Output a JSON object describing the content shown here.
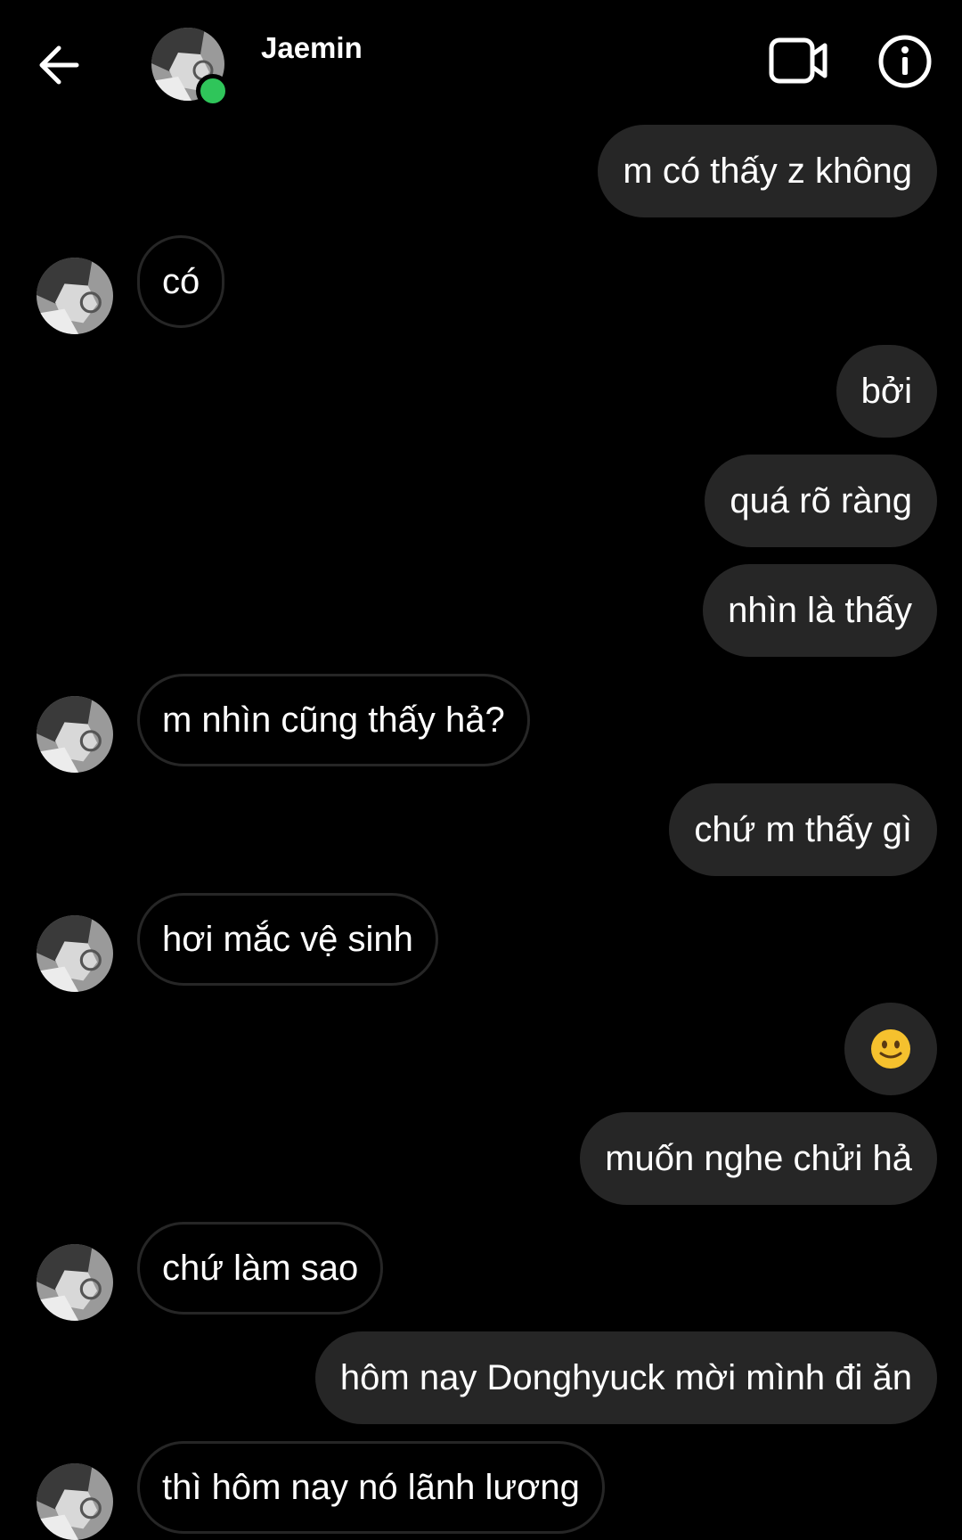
{
  "header": {
    "contact_name": "Jaemin",
    "online_color": "#2fc55a",
    "icons": {
      "back": "arrow-left-icon",
      "video": "video-camera-icon",
      "info": "info-icon"
    }
  },
  "colors": {
    "background": "#000000",
    "outgoing_bubble": "#262626",
    "incoming_border": "#262626",
    "text": "#ffffff"
  },
  "messages": [
    {
      "direction": "out",
      "text": "m có thấy z không"
    },
    {
      "direction": "in",
      "text": "có"
    },
    {
      "direction": "out",
      "text": "bởi"
    },
    {
      "direction": "out",
      "text": "quá rõ ràng"
    },
    {
      "direction": "out",
      "text": "nhìn là thấy"
    },
    {
      "direction": "in",
      "text": "m nhìn cũng thấy hả?"
    },
    {
      "direction": "out",
      "text": "chứ m thấy gì"
    },
    {
      "direction": "in",
      "text": "hơi mắc vệ sinh"
    },
    {
      "direction": "out",
      "emoji": "slightly-smiling-face-icon"
    },
    {
      "direction": "out",
      "text": "muốn nghe chửi hả"
    },
    {
      "direction": "in",
      "text": "chứ làm sao"
    },
    {
      "direction": "out",
      "text": "hôm nay Donghyuck mời mình đi ăn"
    },
    {
      "direction": "in",
      "text": "thì hôm nay nó lãnh lương"
    }
  ]
}
